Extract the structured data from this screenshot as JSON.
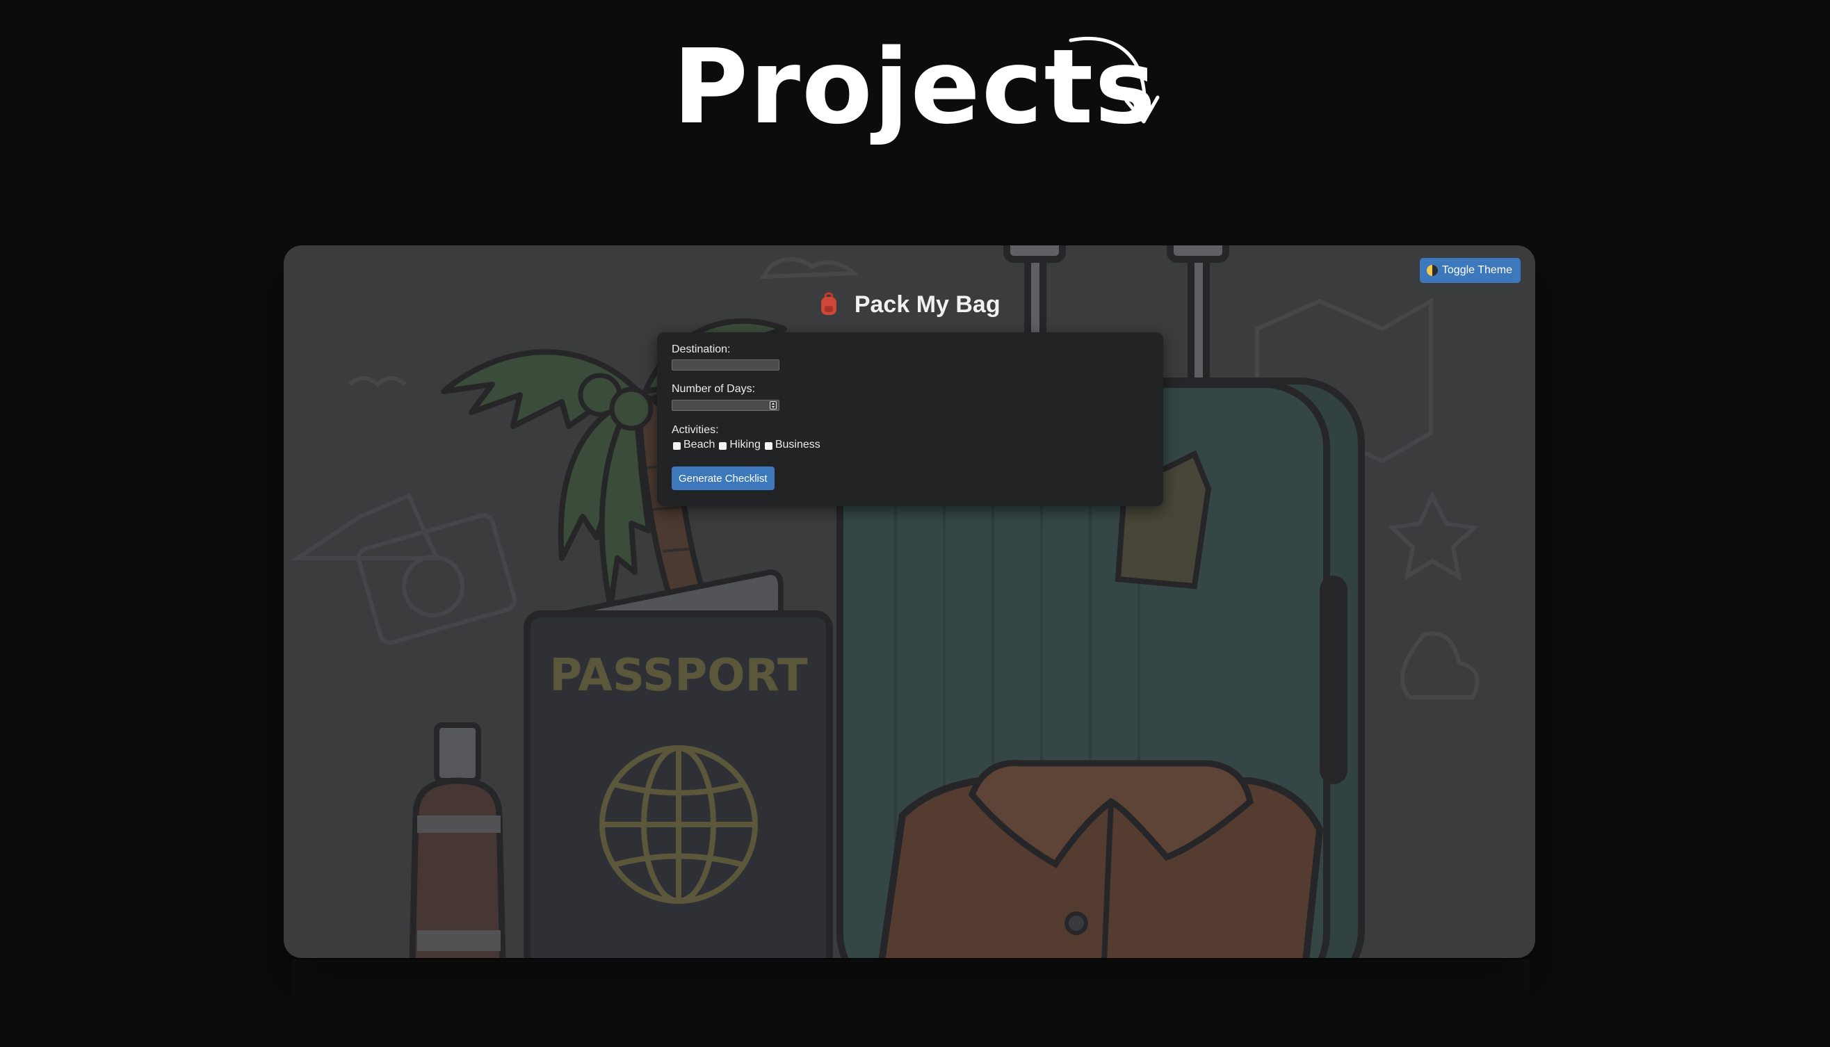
{
  "section": {
    "title": "Projects"
  },
  "app": {
    "title": "Pack My Bag",
    "toggle_label": "Toggle Theme",
    "form": {
      "destination_label": "Destination:",
      "destination_value": "",
      "days_label": "Number of Days:",
      "days_value": "",
      "activities_label": "Activities:",
      "activities": [
        {
          "label": "Beach",
          "checked": false
        },
        {
          "label": "Hiking",
          "checked": false
        },
        {
          "label": "Business",
          "checked": false
        }
      ],
      "generate_label": "Generate Checklist"
    },
    "illustration": {
      "passport_text": "PASSPORT"
    }
  },
  "colors": {
    "page_bg": "#0c0c0c",
    "card_bg": "#3b3c3e",
    "panel_bg": "#222324",
    "accent": "#3d78bd",
    "text": "#ffffff"
  },
  "icons": [
    "curved-arrow-icon",
    "backpack-icon",
    "half-moon-icon"
  ]
}
